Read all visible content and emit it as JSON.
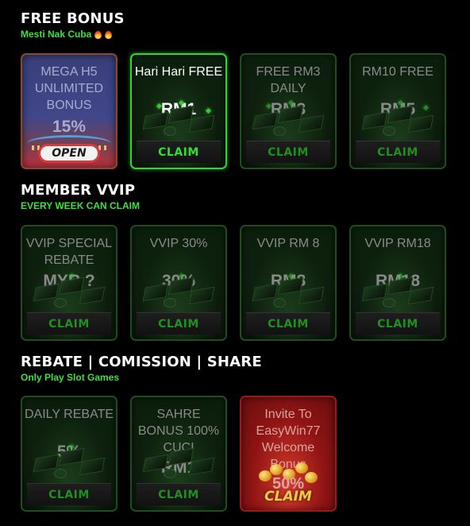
{
  "sections": [
    {
      "title": "FREE BONUS",
      "subtitle": "Mesti Nak Cuba",
      "subtitle_icons": [
        "fire-icon",
        "fire-icon"
      ],
      "cards": [
        {
          "label": "MEGA H5 UNLIMITED BONUS",
          "value": "15%",
          "button": "OPEN",
          "style": "mega"
        },
        {
          "label": "Hari Hari FREE",
          "value": "RM1",
          "button": "CLAIM",
          "style": "bright"
        },
        {
          "label": "FREE RM3 DAILY",
          "value": "RM3",
          "button": "CLAIM",
          "style": "dim"
        },
        {
          "label": "RM10 FREE",
          "value": "RM5",
          "button": "CLAIM",
          "style": "dim"
        }
      ]
    },
    {
      "title": "MEMBER VVIP",
      "subtitle": "EVERY WEEK CAN CLAIM",
      "cards": [
        {
          "label": "VVIP SPECIAL REBATE",
          "value": "MYR ?",
          "button": "CLAIM",
          "style": "dim"
        },
        {
          "label": "VVIP 30%",
          "value": "30%",
          "button": "CLAIM",
          "style": "dim"
        },
        {
          "label": "VVIP RM 8",
          "value": "RM8",
          "button": "CLAIM",
          "style": "dim"
        },
        {
          "label": "VVIP RM18",
          "value": "RM18",
          "button": "CLAIM",
          "style": "dim"
        }
      ]
    },
    {
      "title": "REBATE | COMISSION | SHARE",
      "subtitle": "Only Play Slot Games",
      "cards": [
        {
          "label": "DAILY REBATE",
          "value": "5%",
          "button": "CLAIM",
          "style": "dim"
        },
        {
          "label": "SAHRE BONUS 100% CUCI",
          "value": "RM1",
          "button": "CLAIM",
          "style": "dim"
        },
        {
          "label": "Invite To EasyWin77 Welcome Bonus",
          "value": "50%",
          "button": "CLAIM",
          "style": "invite"
        }
      ]
    }
  ],
  "colors": {
    "accent_green": "#3ee03e",
    "claim_dim": "#1f8f1f",
    "background": "#000000",
    "invite_red": "#8f1414",
    "mega_blue": "#40478a"
  }
}
